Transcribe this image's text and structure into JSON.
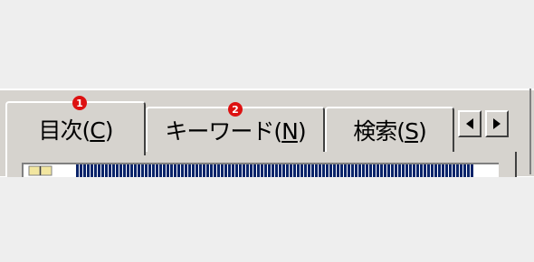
{
  "tabs": [
    {
      "label_prefix": "目次(",
      "mnemonic": "C",
      "label_suffix": ")",
      "active": true
    },
    {
      "label_prefix": "キーワード(",
      "mnemonic": "N",
      "label_suffix": ")",
      "active": false
    },
    {
      "label_prefix": "検索(",
      "mnemonic": "S",
      "label_suffix": ")",
      "active": false
    }
  ],
  "badges": [
    "1",
    "2"
  ],
  "scroll": {
    "left_icon": "triangle-left-icon",
    "right_icon": "triangle-right-icon"
  },
  "colors": {
    "badge": "#dd1111",
    "selection": "#0a246a",
    "face": "#d6d3ce"
  }
}
